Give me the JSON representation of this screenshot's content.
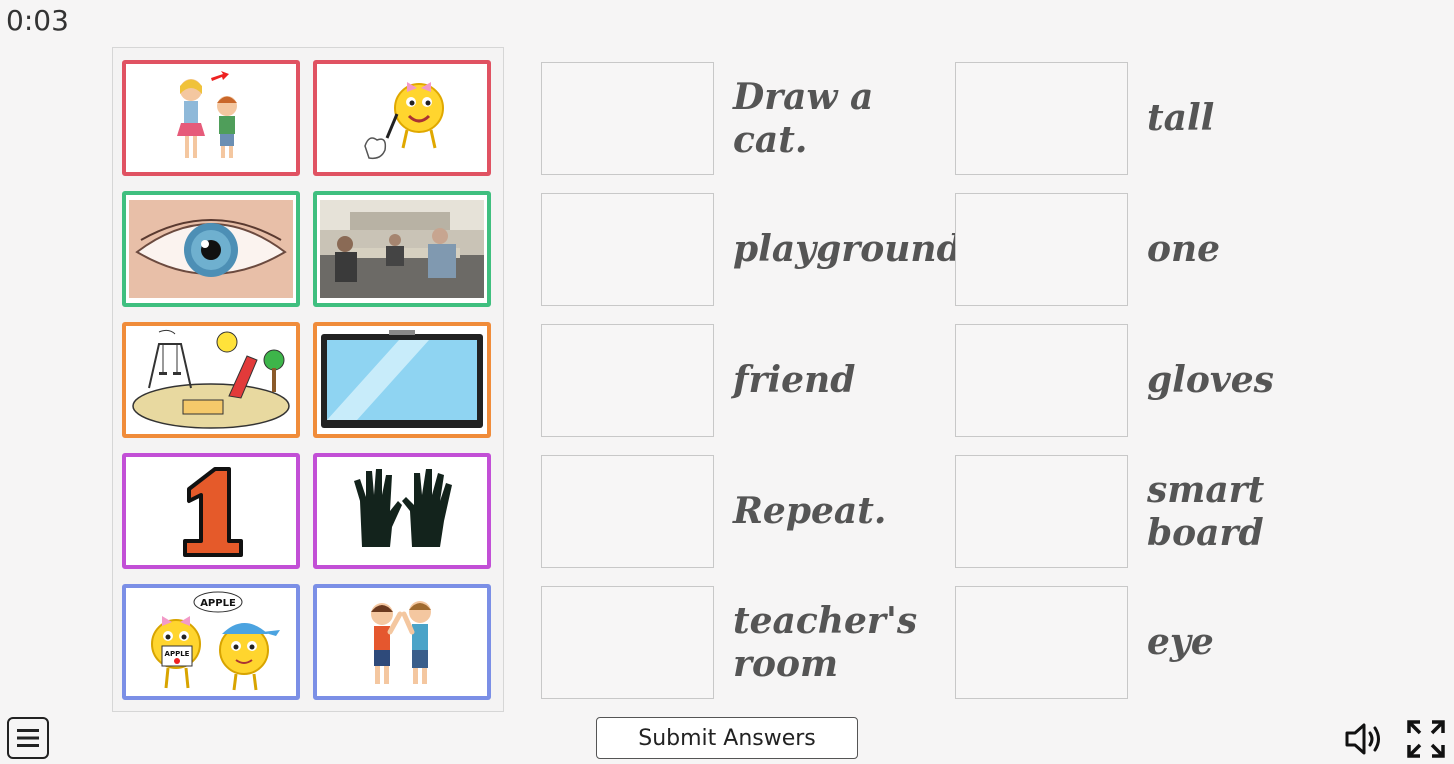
{
  "timer": "0:03",
  "picture_cards": [
    {
      "name": "tall-card",
      "icon": "tall-children-picture",
      "border": "#e05262"
    },
    {
      "name": "draw-cat-card",
      "icon": "smiley-drawing-cat-picture",
      "border": "#e05262"
    },
    {
      "name": "eye-card",
      "icon": "eye-picture",
      "border": "#3fbf7f"
    },
    {
      "name": "teachers-room-card",
      "icon": "teachers-room-picture",
      "border": "#3fbf7f"
    },
    {
      "name": "playground-card",
      "icon": "playground-picture",
      "border": "#f08c3a"
    },
    {
      "name": "smart-board-card",
      "icon": "smart-board-picture",
      "border": "#f08c3a"
    },
    {
      "name": "one-card",
      "icon": "number-one-picture",
      "border": "#c24fd6"
    },
    {
      "name": "gloves-card",
      "icon": "gloves-picture",
      "border": "#c24fd6"
    },
    {
      "name": "repeat-card",
      "icon": "smileys-repeat-apple-picture",
      "border": "#7b8fe6"
    },
    {
      "name": "friend-card",
      "icon": "friends-picture",
      "border": "#7b8fe6"
    }
  ],
  "apple_label": "APPLE",
  "apple_sign": "APPLE",
  "one_digit": "1",
  "words_left": [
    "Draw a cat.",
    "playground",
    "friend",
    "Repeat.",
    "teacher's room"
  ],
  "words_right": [
    "tall",
    "one",
    "gloves",
    "smart board",
    "eye"
  ],
  "submit_label": "Submit Answers",
  "icons": {
    "menu": "menu-icon",
    "sound": "speaker-icon",
    "fullscreen": "fullscreen-icon"
  }
}
